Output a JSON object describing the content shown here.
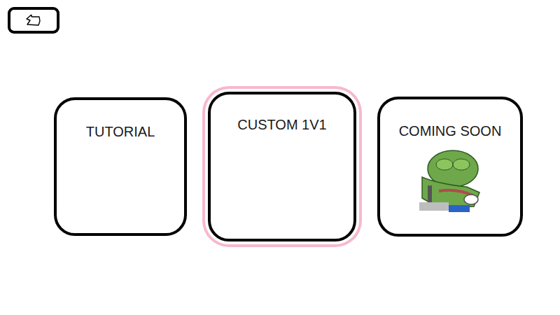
{
  "back_button": {
    "label": ""
  },
  "cards": [
    {
      "title": "TUTORIAL",
      "selected": false,
      "kind": "plain"
    },
    {
      "title": "CUSTOM 1V1",
      "selected": true,
      "kind": "plain"
    },
    {
      "title": "COMING SOON",
      "selected": false,
      "kind": "picture"
    }
  ]
}
